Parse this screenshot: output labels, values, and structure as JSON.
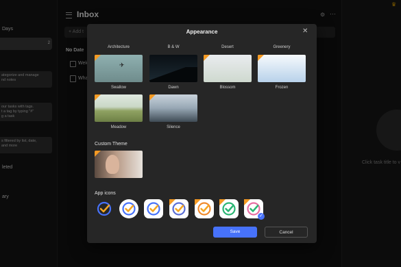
{
  "sidebar": {
    "days_label": "Days",
    "count": "2",
    "tip1": "ategorize and manage\nnd notes",
    "tip2": "our tasks with tags.\nt a tag by typing \"#\"\ng a task",
    "tip3": "s filtered by list, date,\nand more",
    "leted_label": "leted",
    "ary_label": "ary"
  },
  "main": {
    "title": "Inbox",
    "add_task_placeholder": "+ Add t",
    "section_no_date": "No Date",
    "task1": "Wek",
    "task2": "Wha"
  },
  "right": {
    "hint": "Click task title to v"
  },
  "dialog": {
    "title": "Appearance",
    "headers": [
      "Architecture",
      "B & W",
      "Desert",
      "Greenery"
    ],
    "themes": [
      "Swallow",
      "Dawn",
      "Blossom",
      "Frozen",
      "Meadow",
      "Silence"
    ],
    "custom_theme": "Custom Theme",
    "app_icons": "App icons",
    "save": "Save",
    "cancel": "Cancel"
  },
  "colors": {
    "accent": "#4772fa",
    "badge": "#f59a23"
  }
}
